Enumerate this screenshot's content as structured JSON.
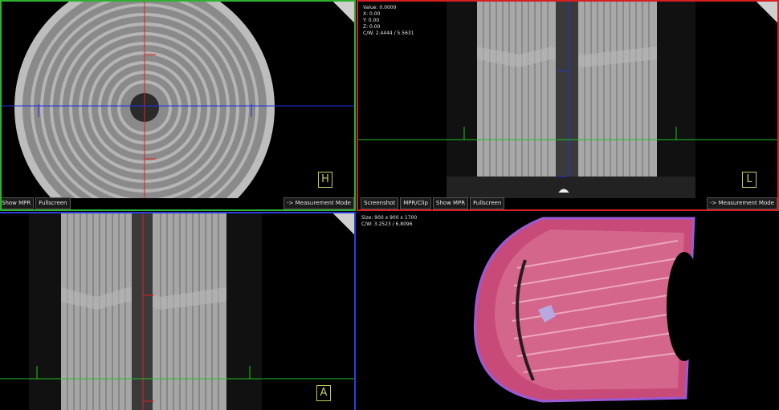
{
  "viewports": {
    "axial": {
      "orientation_label": "H",
      "toolbar": {
        "show_mpr": "Show MPR",
        "fullscreen": "Fullscreen",
        "measurement": "-> Measurement Mode"
      }
    },
    "sagittal": {
      "orientation_label": "L",
      "info": {
        "value": "Value: 0.0000",
        "x": "X: 0.00",
        "y": "Y: 0.00",
        "z": "Z: 0.00",
        "cw": "C/W: 2.4444 / 5.5631"
      },
      "toolbar": {
        "screenshot": "Screenshot",
        "mpr_clip": "MPR/Clip",
        "show_mpr": "Show MPR",
        "fullscreen": "Fullscreen",
        "measurement": "-> Measurement Mode"
      }
    },
    "coronal": {
      "orientation_label": "A"
    },
    "volume": {
      "info": {
        "size": "Size: 900 x 900 x 1700",
        "cw": "C/W: 3.2523 / 6.8096"
      }
    }
  },
  "colors": {
    "axial_border": "#2fb12f",
    "sagittal_border": "#d42020",
    "coronal_border": "#2b3fd8",
    "crosshair_red": "#e02020",
    "crosshair_blue": "#2030e0",
    "crosshair_green": "#20c020",
    "volume_tint": "#e0507a"
  }
}
